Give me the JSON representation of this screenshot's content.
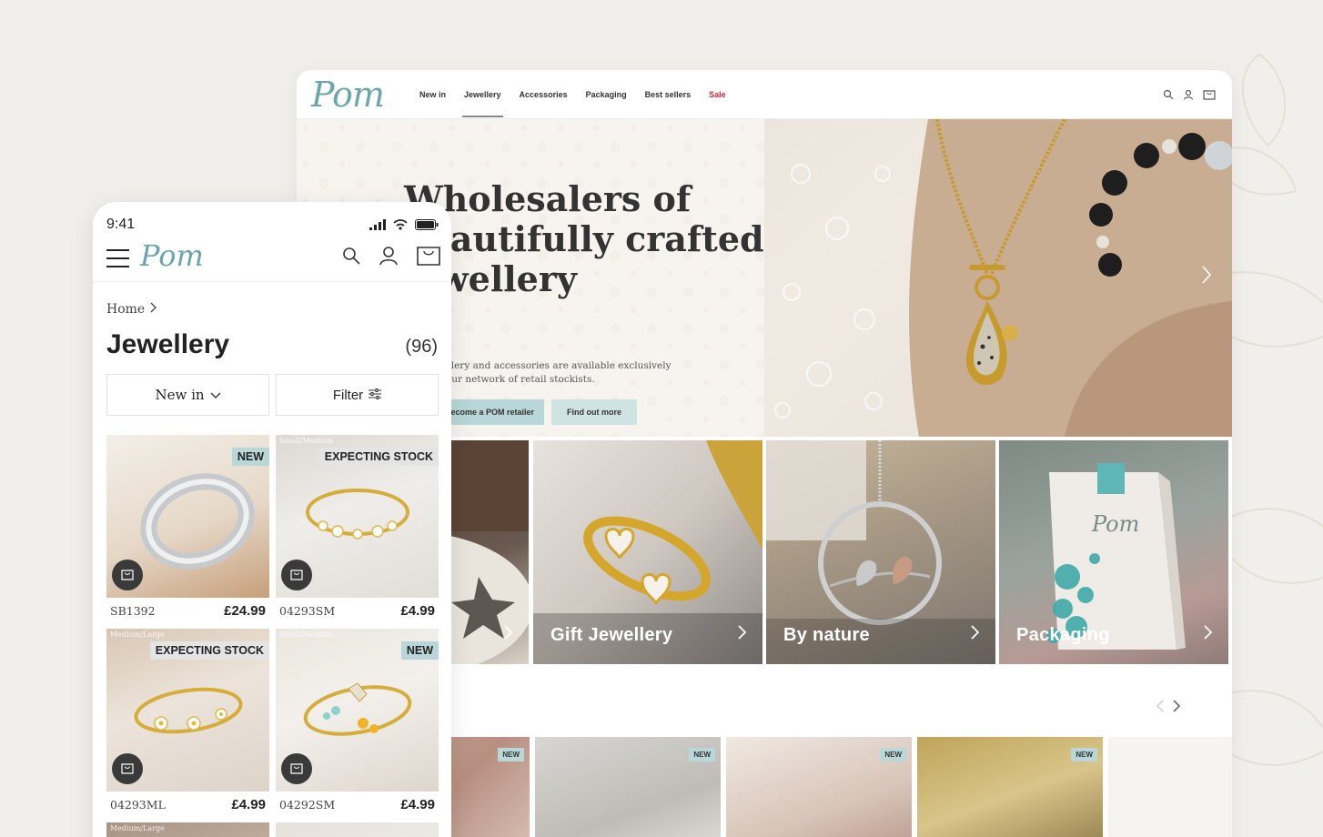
{
  "colors": {
    "accent": "#b9d7d8",
    "logo": "#6aa6ab",
    "sale": "#d7263d",
    "background": "#f1efeb"
  },
  "desktop": {
    "logo": "Pom",
    "nav": [
      {
        "label": "New in"
      },
      {
        "label": "Jewellery"
      },
      {
        "label": "Accessories"
      },
      {
        "label": "Packaging"
      },
      {
        "label": "Best sellers"
      },
      {
        "label": "Sale"
      }
    ],
    "icons": [
      "search-icon",
      "account-icon",
      "bag-icon"
    ],
    "hero": {
      "title_lines": [
        "Wholesalers of",
        "beautifully crafted",
        "jewellery"
      ],
      "subtitle_lines": [
        "Our jewellery and accessories are available exclusively",
        "through our network of retail stockists."
      ],
      "button_primary": "Become a POM retailer",
      "button_secondary": "Find out more"
    },
    "categories": [
      {
        "label": ""
      },
      {
        "label": "Gift Jewellery"
      },
      {
        "label": "By nature"
      },
      {
        "label": "Packaging"
      }
    ],
    "products": [
      {
        "badge": "NEW"
      },
      {
        "badge": "NEW"
      },
      {
        "badge": "NEW"
      },
      {
        "badge": "NEW"
      }
    ]
  },
  "mobile": {
    "time": "9:41",
    "logo": "Pom",
    "breadcrumb": "Home",
    "title": "Jewellery",
    "count": "(96)",
    "sort_label": "New in",
    "filter_label": "Filter",
    "products": [
      {
        "sku": "SB1392",
        "price": "£24.99",
        "tag": "NEW",
        "size": ""
      },
      {
        "sku": "04293SM",
        "price": "£4.99",
        "tag": "EXPECTING STOCK",
        "size": "Small/Medium"
      },
      {
        "sku": "04293ML",
        "price": "£4.99",
        "tag": "EXPECTING STOCK",
        "size": "Medium/Large"
      },
      {
        "sku": "04292SM",
        "price": "£4.99",
        "tag": "NEW",
        "size": "Small/Medium"
      }
    ],
    "next_row_size": "Medium/Large"
  }
}
